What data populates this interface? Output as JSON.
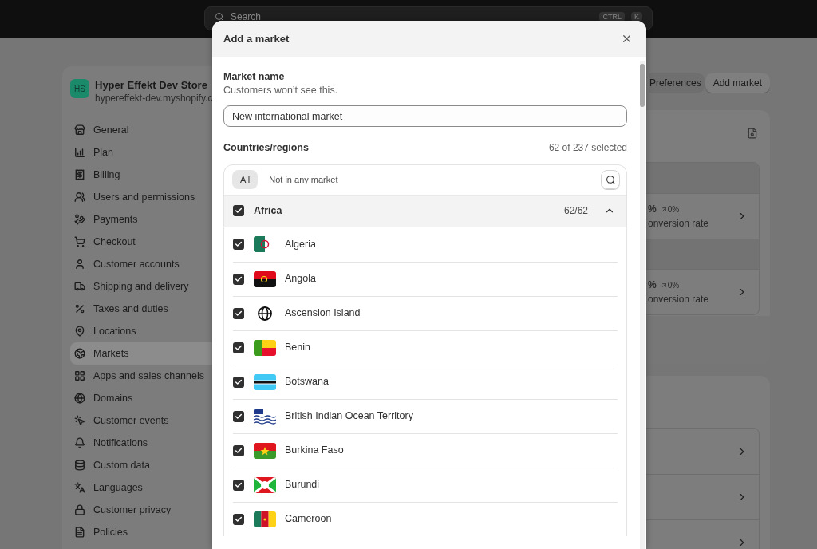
{
  "top_bar": {
    "search": {
      "placeholder": "Search"
    },
    "shortcut": [
      "CTRL",
      "K"
    ]
  },
  "store": {
    "initials": "HS",
    "name": "Hyper Effekt Dev Store",
    "url": "hypereffekt-dev.myshopify.c"
  },
  "sidebar": {
    "items": [
      {
        "label": "General",
        "selected": false
      },
      {
        "label": "Plan",
        "selected": false
      },
      {
        "label": "Billing",
        "selected": false
      },
      {
        "label": "Users and permissions",
        "selected": false
      },
      {
        "label": "Payments",
        "selected": false
      },
      {
        "label": "Checkout",
        "selected": false
      },
      {
        "label": "Customer accounts",
        "selected": false
      },
      {
        "label": "Shipping and delivery",
        "selected": false
      },
      {
        "label": "Taxes and duties",
        "selected": false
      },
      {
        "label": "Locations",
        "selected": false
      },
      {
        "label": "Markets",
        "selected": true
      },
      {
        "label": "Apps and sales channels",
        "selected": false
      },
      {
        "label": "Domains",
        "selected": false
      },
      {
        "label": "Customer events",
        "selected": false
      },
      {
        "label": "Notifications",
        "selected": false
      },
      {
        "label": "Custom data",
        "selected": false
      },
      {
        "label": "Languages",
        "selected": false
      },
      {
        "label": "Customer privacy",
        "selected": false
      },
      {
        "label": "Policies",
        "selected": false
      }
    ]
  },
  "header_buttons": [
    "Preferences",
    "Add market"
  ],
  "market_rows": [
    {
      "value": "%",
      "change": "0%",
      "label": "onversion rate"
    },
    {
      "value": "%",
      "change": "0%",
      "label": "onversion rate"
    }
  ],
  "modal": {
    "title": "Add a market",
    "market_name": {
      "label": "Market name",
      "help": "Customers won’t see this.",
      "value": "New international market"
    },
    "countries": {
      "label": "Countries/regions",
      "count": "62 of 237 selected",
      "filters": [
        {
          "label": "All",
          "selected": true
        },
        {
          "label": "Not in any market",
          "selected": false
        }
      ],
      "group": {
        "name": "Africa",
        "checked": true,
        "count": "62/62",
        "expanded": true
      },
      "items": [
        {
          "name": "Algeria",
          "checked": true
        },
        {
          "name": "Angola",
          "checked": true
        },
        {
          "name": "Ascension Island",
          "checked": true
        },
        {
          "name": "Benin",
          "checked": true
        },
        {
          "name": "Botswana",
          "checked": true
        },
        {
          "name": "British Indian Ocean Territory",
          "checked": true
        },
        {
          "name": "Burkina Faso",
          "checked": true
        },
        {
          "name": "Burundi",
          "checked": true
        },
        {
          "name": "Cameroon",
          "checked": true
        }
      ]
    }
  }
}
